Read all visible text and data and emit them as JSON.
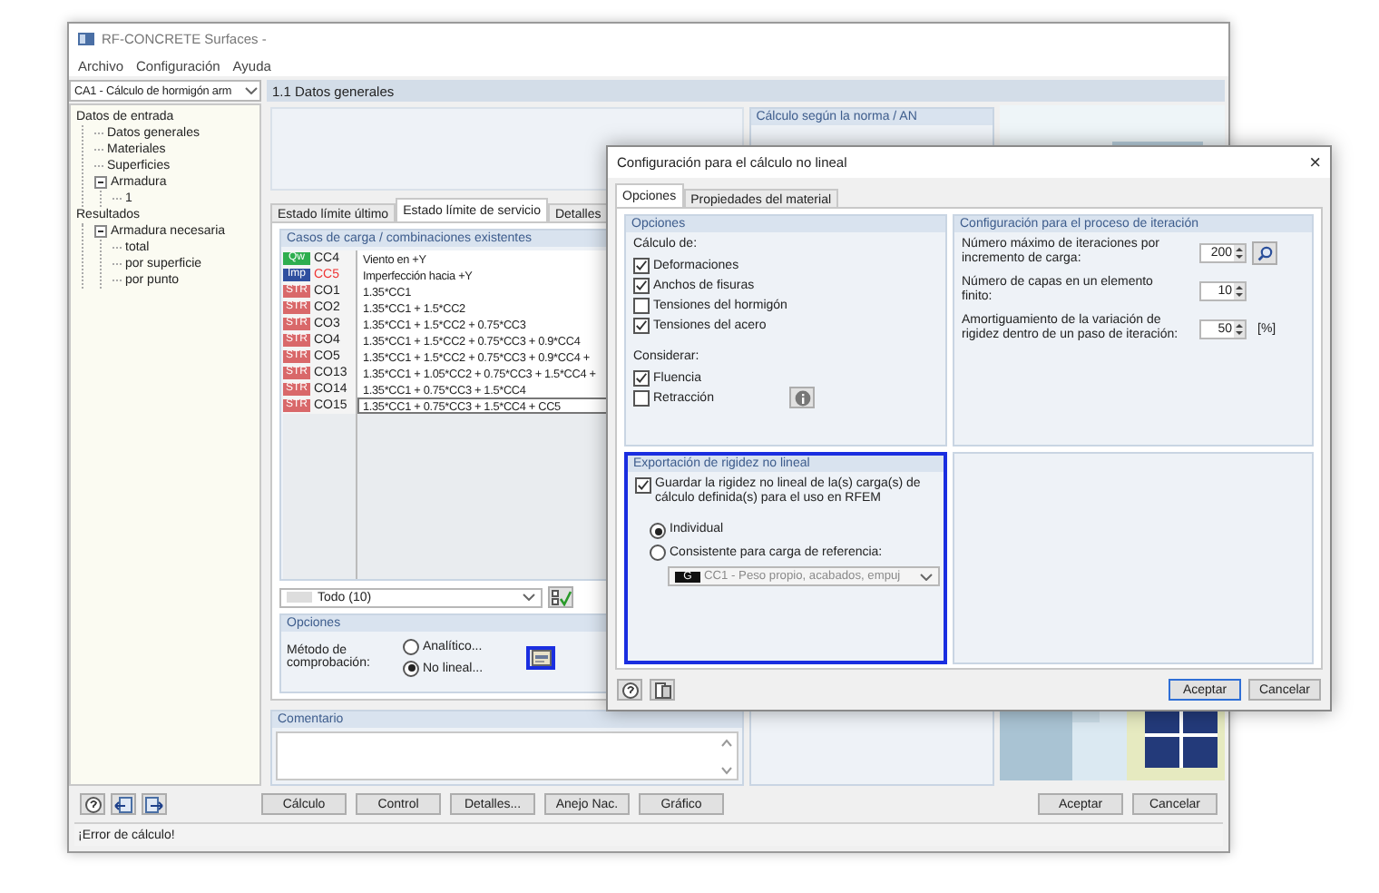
{
  "window": {
    "title": "RF-CONCRETE Surfaces -"
  },
  "menu": [
    "Archivo",
    "Configuración",
    "Ayuda"
  ],
  "case_selector": {
    "value": "CA1 - Cálculo de hormigón arm"
  },
  "tree": [
    {
      "label": "Datos de entrada",
      "children": [
        {
          "label": "Datos generales"
        },
        {
          "label": "Materiales"
        },
        {
          "label": "Superficies"
        },
        {
          "label": "Armadura",
          "expanded": true,
          "children": [
            {
              "label": "1"
            }
          ]
        }
      ]
    },
    {
      "label": "Resultados",
      "children": [
        {
          "label": "Armadura necesaria",
          "expanded": true,
          "children": [
            {
              "label": "total"
            },
            {
              "label": "por superficie"
            },
            {
              "label": "por punto"
            }
          ]
        }
      ]
    }
  ],
  "section_header": "1.1 Datos generales",
  "norm": {
    "title": "Cálculo según la norma / AN"
  },
  "tabs": [
    {
      "label": "Estado límite último",
      "selected": false
    },
    {
      "label": "Estado límite de servicio",
      "selected": true
    },
    {
      "label": "Detalles",
      "selected": false
    }
  ],
  "load_cases": {
    "title": "Casos de carga / combinaciones existentes",
    "rows": [
      {
        "tag": "Qw",
        "color": "#2eae4e",
        "name": "CC4",
        "flagged": false,
        "description": "Viento en +Y",
        "selected": false
      },
      {
        "tag": "Imp",
        "color": "#2f4f9f",
        "name": "CC5",
        "flagged": true,
        "description": "Imperfección hacia +Y",
        "selected": false
      },
      {
        "tag": "STR",
        "color": "#d9686a",
        "name": "CO1",
        "flagged": false,
        "description": "1.35*CC1",
        "selected": false
      },
      {
        "tag": "STR",
        "color": "#d9686a",
        "name": "CO2",
        "flagged": false,
        "description": "1.35*CC1 + 1.5*CC2",
        "selected": false
      },
      {
        "tag": "STR",
        "color": "#d9686a",
        "name": "CO3",
        "flagged": false,
        "description": "1.35*CC1 + 1.5*CC2 + 0.75*CC3",
        "selected": false
      },
      {
        "tag": "STR",
        "color": "#d9686a",
        "name": "CO4",
        "flagged": false,
        "description": "1.35*CC1 + 1.5*CC2 + 0.75*CC3 + 0.9*CC4",
        "selected": false
      },
      {
        "tag": "STR",
        "color": "#d9686a",
        "name": "CO5",
        "flagged": false,
        "description": "1.35*CC1 + 1.5*CC2 + 0.75*CC3 + 0.9*CC4 +",
        "selected": false
      },
      {
        "tag": "STR",
        "color": "#d9686a",
        "name": "CO13",
        "flagged": false,
        "description": "1.35*CC1 + 1.05*CC2 + 0.75*CC3 + 1.5*CC4 +",
        "selected": false
      },
      {
        "tag": "STR",
        "color": "#d9686a",
        "name": "CO14",
        "flagged": false,
        "description": "1.35*CC1 + 0.75*CC3 + 1.5*CC4",
        "selected": false
      },
      {
        "tag": "STR",
        "color": "#d9686a",
        "name": "CO15",
        "flagged": false,
        "description": "1.35*CC1 + 0.75*CC3 + 1.5*CC4 + CC5",
        "selected": true
      }
    ]
  },
  "filter": {
    "value": "Todo (10)"
  },
  "options": {
    "title": "Opciones",
    "label": "Método de comprobación:",
    "methods": [
      {
        "label": "Analítico...",
        "selected": false
      },
      {
        "label": "No lineal...",
        "selected": true
      }
    ],
    "settings_button": {
      "highlighted": true
    }
  },
  "comment": {
    "title": "Comentario"
  },
  "buttons": [
    "Cálculo",
    "Control",
    "Detalles...",
    "Anejo Nac.",
    "Gráfico"
  ],
  "buttons_right": [
    "Aceptar",
    "Cancelar"
  ],
  "status_bar": "¡Error de cálculo!",
  "dialog": {
    "title": "Configuración para el cálculo no lineal",
    "close": "×",
    "tabs": [
      {
        "label": "Opciones",
        "selected": true
      },
      {
        "label": "Propiedades del material",
        "selected": false
      }
    ],
    "options": {
      "title": "Opciones",
      "calc_label": "Cálculo de:",
      "calc": [
        {
          "label": "Deformaciones",
          "checked": true
        },
        {
          "label": "Anchos de fisuras",
          "checked": true
        },
        {
          "label": "Tensiones del hormigón",
          "checked": false
        },
        {
          "label": "Tensiones del acero",
          "checked": true
        }
      ],
      "consider_label": "Considerar:",
      "consider": [
        {
          "label": "Fluencia",
          "checked": true
        },
        {
          "label": "Retracción",
          "checked": false
        }
      ]
    },
    "iteration": {
      "title": "Configuración para el proceso de iteración",
      "rows": [
        {
          "label": "Número máximo de iteraciones por incremento de carga:",
          "value": "200",
          "unit": "",
          "search": true
        },
        {
          "label": "Número de capas en un elemento finito:",
          "value": "10",
          "unit": "",
          "search": false
        },
        {
          "label": "Amortiguamiento de la variación de rigidez dentro de un paso de iteración:",
          "value": "50",
          "unit": "[%]",
          "search": false
        }
      ]
    },
    "export": {
      "title": "Exportación de rigidez no lineal",
      "highlighted": true,
      "save": {
        "label": "Guardar la rigidez no lineal de la(s) carga(s) de cálculo definida(s) para el uso en RFEM",
        "checked": true
      },
      "modes": [
        {
          "label": "Individual",
          "selected": true
        },
        {
          "label": "Consistente para carga de referencia:",
          "selected": false
        }
      ],
      "reference": {
        "tag": "G",
        "value": "CC1 - Peso propio, acabados, empuj",
        "disabled": true
      }
    },
    "buttons": [
      "Aceptar",
      "Cancelar"
    ]
  }
}
